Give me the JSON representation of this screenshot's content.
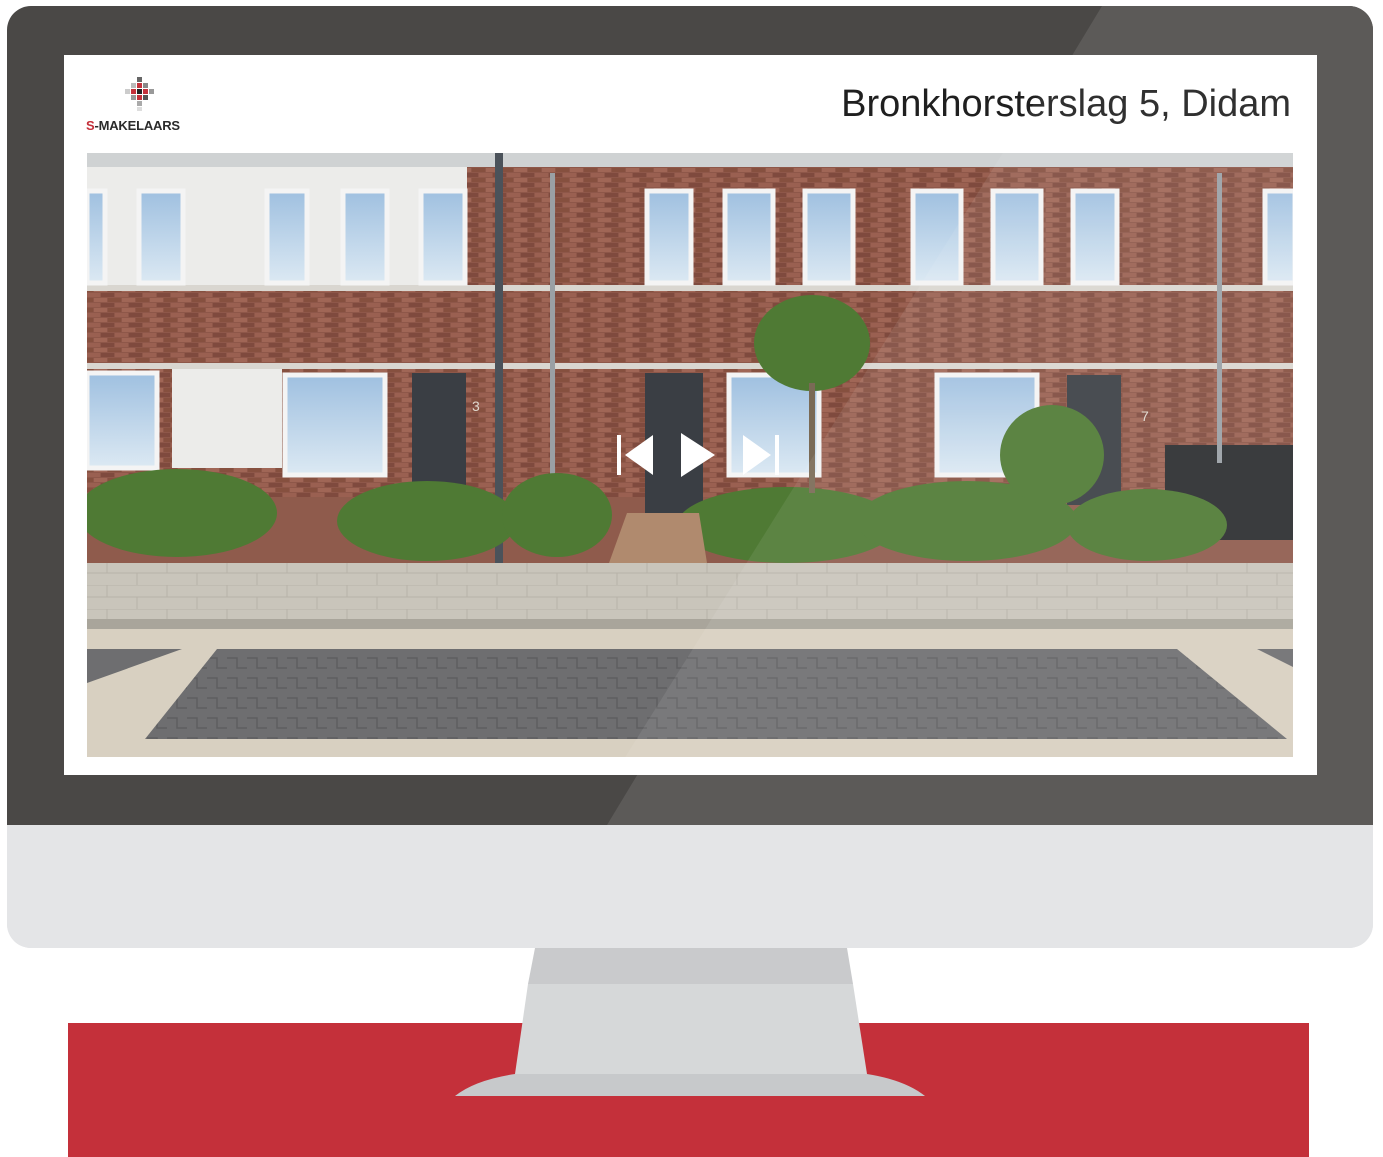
{
  "logo": {
    "prefix": "S",
    "rest": "-MAKELAARS"
  },
  "listing": {
    "address": "Bronkhorsterslag 5, Didam"
  },
  "photo": {
    "house_numbers": [
      "3",
      "7"
    ],
    "description": ""
  },
  "controls": {
    "previous_icon": "skip-back-icon",
    "play_icon": "play-icon",
    "next_icon": "skip-forward-icon"
  },
  "colors": {
    "brand_red": "#c4303a",
    "bezel": "#4a4846",
    "chin": "#e4e5e7",
    "brick": "#8f5b4c"
  }
}
